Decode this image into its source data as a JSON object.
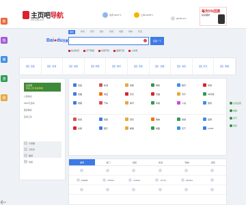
{
  "header": {
    "logo_main": "主页吧",
    "logo_accent": "导航",
    "logo_sub": "ZhuYeBa.Com",
    "weather": [
      {
        "city": "北京",
        "temp": "18/27°C",
        "icon": "sun-cloud-icon"
      },
      {
        "city": "上海",
        "temp": "19/28°C",
        "icon": "sun-icon"
      }
    ],
    "user_text": "@163.com",
    "ad_title": "每天5%回报",
    "ad_sub": "投资理财"
  },
  "rail": [
    {
      "label": "新",
      "color": "#e86a3a"
    },
    {
      "label": "热",
      "color": "#a25ad6"
    },
    {
      "label": "娱",
      "color": "#3e8ee6"
    },
    {
      "label": "游",
      "color": "#2f9b55"
    },
    {
      "label": "购",
      "color": "#e6a93e"
    }
  ],
  "search": {
    "tabs": [
      "网页",
      "新闻",
      "音乐",
      "图片",
      "视频",
      "地图",
      "购物",
      "知道"
    ],
    "active_tab": 0,
    "engine": "Bai",
    "engine_accent": "du",
    "engine_suffix": "百度",
    "button": "百度一下",
    "hot": [
      "热点新闻",
      "天气预报",
      "彩票开奖",
      "股票行情",
      "火车票"
    ]
  },
  "site_strip": [
    "百度",
    "新浪",
    "搜狐",
    "网易",
    "腾讯",
    "凤凰",
    "优酷",
    "淘宝",
    "京东",
    "携程"
  ],
  "left_panel": {
    "promo_line1": "主页吧",
    "promo_line2": "新版上线 快来体验",
    "lines": [
      "· 公告信息",
      "· 4999元活动",
      "· 更多精彩",
      "· 实用工具"
    ],
    "tools": [
      "计算器",
      "万年历",
      "翻译",
      "快递"
    ]
  },
  "grid_top": [
    {
      "label": "百度",
      "color": "#3e7ae6"
    },
    {
      "label": "新浪",
      "color": "#e14b4b"
    },
    {
      "label": "搜狐",
      "color": "#e6a93e"
    },
    {
      "label": "网易",
      "color": "#2f9b55"
    },
    {
      "label": "腾讯",
      "color": "#3e8ee6"
    },
    {
      "label": "凤凰",
      "color": "#d9232f"
    },
    {
      "label": "优酷",
      "color": "#3e7ae6"
    },
    {
      "label": "淘宝",
      "color": "#ff6a00"
    },
    {
      "label": "京东",
      "color": "#d9232f"
    },
    {
      "label": "天猫",
      "color": "#d9232f"
    },
    {
      "label": "苏宁",
      "color": "#e6a93e"
    },
    {
      "label": "58同城",
      "color": "#2f9b55"
    },
    {
      "label": "携程",
      "color": "#3e7ae6"
    },
    {
      "label": "汽车",
      "color": "#e14b4b"
    },
    {
      "label": "体育",
      "color": "#e6a93e"
    },
    {
      "label": "军事",
      "color": "#2f9b55"
    },
    {
      "label": "小说",
      "color": "#c84be1"
    },
    {
      "label": "游戏",
      "color": "#3e8ee6"
    }
  ],
  "grid_bottom": [
    {
      "label": "新闻",
      "color": "#e14b4b"
    },
    {
      "label": "视频",
      "color": "#3e7ae6"
    },
    {
      "label": "音乐",
      "color": "#e6a93e"
    },
    {
      "label": "购物",
      "color": "#ff6a00"
    },
    {
      "label": "旅游",
      "color": "#2f9b55"
    },
    {
      "label": "招聘",
      "color": "#3e8ee6"
    },
    {
      "label": "彩票",
      "color": "#d9232f"
    },
    {
      "label": "银行",
      "color": "#3e7ae6"
    },
    {
      "label": "邮箱",
      "color": "#e6a93e"
    },
    {
      "label": "地图",
      "color": "#2f9b55"
    },
    {
      "label": "天气",
      "color": "#3e8ee6"
    },
    {
      "label": "12306",
      "color": "#3e7ae6"
    }
  ],
  "right_rail": [
    "主页设置",
    "换肤",
    "天气",
    "意见"
  ],
  "bottom": {
    "tabs": [
      "推荐",
      "热门",
      "视频",
      "新闻",
      "购物",
      "游戏"
    ],
    "active_tab": 0,
    "rows": [
      [
        "",
        "",
        "",
        "",
        "",
        ""
      ],
      [
        "439993",
        "767611",
        "214411",
        "17173",
        "667611",
        ""
      ],
      [
        "",
        "",
        "",
        "",
        "",
        ""
      ]
    ]
  }
}
